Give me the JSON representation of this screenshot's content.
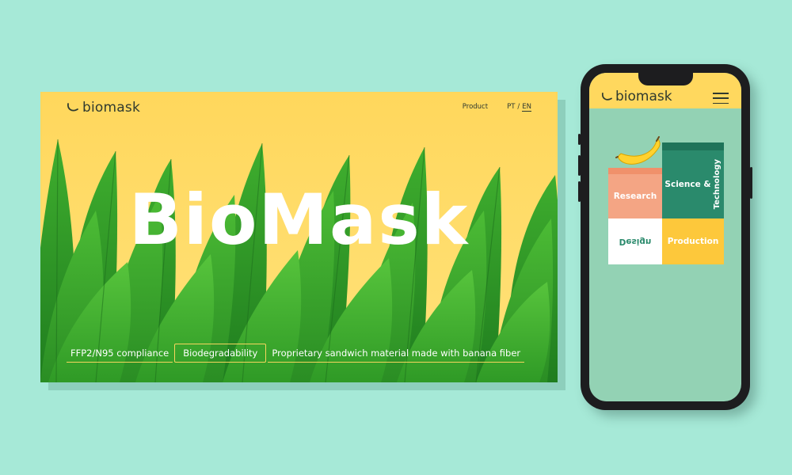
{
  "desktop": {
    "logo_text": "biomask",
    "nav": {
      "product": "Product",
      "lang_pt": "PT",
      "lang_sep": "/",
      "lang_en": "EN"
    },
    "hero_title": "BioMask",
    "features": [
      "FFP2/N95 compliance",
      "Biodegradability",
      "Proprietary sandwich material made with banana fiber"
    ]
  },
  "phone": {
    "logo_text": "biomask",
    "blocks": {
      "research": "Research",
      "science": "Science &",
      "technology": "Technology",
      "design": "Design",
      "production": "Production"
    }
  },
  "colors": {
    "background": "#a6e9d7",
    "sky_yellow": "#ffd85e",
    "leaf_green": "#2e9a2a",
    "accent_yellow": "#f6d55d",
    "research_salmon": "#f4a584",
    "science_teal": "#2a8a6c",
    "production_yellow": "#fdc83b"
  },
  "icons": [
    "banana-logo-icon",
    "hamburger-menu-icon",
    "banana-icon"
  ]
}
